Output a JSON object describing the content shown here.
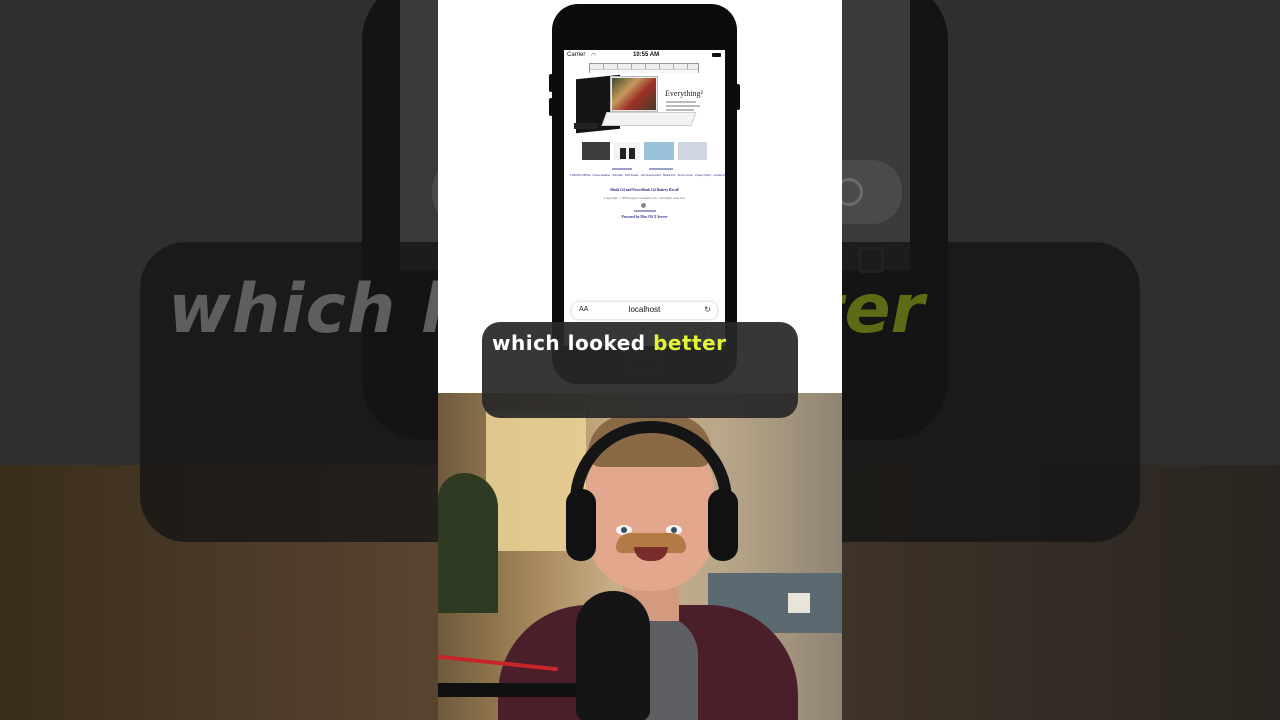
{
  "caption": {
    "prefix": "which looked ",
    "highlight": "better",
    "bg_echo_prefix": "which lo",
    "bg_echo_highlight": "ter"
  },
  "phone": {
    "status": {
      "carrier": "Carrier",
      "wifi_icon": "wifi-icon",
      "time": "10:55 AM"
    },
    "webpage": {
      "hero_title": "Everything²",
      "footer_links": "1-800-MY-APPLE · Find a Reseller · Site Map · RSS Feeds · Job Opportunities · Media Info · Terms of Use · Privacy Policy · Contact Us",
      "recall_notice": "iBook G4 and PowerBook G4 Battery Recall",
      "copyright": "Copyright © 2006 Apple Computer, Inc. All rights reserved.",
      "powered_by": "Powered by Mac OS X Server"
    },
    "url_bar": {
      "aa_label": "AA",
      "url": "localhost",
      "reload_icon": "reload-icon"
    },
    "toolbar_icons": [
      "back-icon",
      "forward-icon",
      "share-icon",
      "bookmarks-icon",
      "tabs-icon"
    ]
  },
  "colors": {
    "highlight": "#e4f43a",
    "caption_bg": "#282828",
    "link": "#2a2a8a"
  }
}
